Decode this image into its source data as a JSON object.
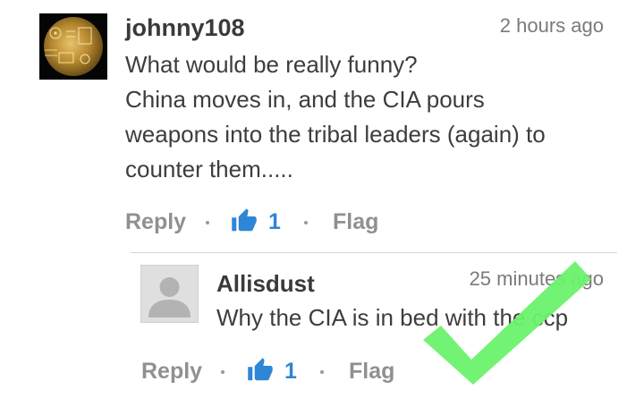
{
  "comment": {
    "username": "johnny108",
    "timestamp": "2 hours ago",
    "body_lines": [
      "What would be really funny?",
      "China moves in, and the CIA pours",
      "weapons into the tribal leaders (again) to",
      "counter them....."
    ],
    "actions": {
      "reply_label": "Reply",
      "like_count": "1",
      "flag_label": "Flag"
    },
    "avatar_icon": "golden-record-avatar"
  },
  "reply": {
    "username": "Allisdust",
    "timestamp": "25 minutes ago",
    "body": "Why the CIA is in bed with the ccp",
    "actions": {
      "reply_label": "Reply",
      "like_count": "1",
      "flag_label": "Flag"
    },
    "avatar_icon": "default-user-avatar"
  },
  "overlay": {
    "icon": "green-checkmark-icon",
    "color": "#6cf26c"
  },
  "colors": {
    "like_blue": "#2e86d6",
    "muted_gray": "#909090",
    "text": "#3d3d3d"
  }
}
